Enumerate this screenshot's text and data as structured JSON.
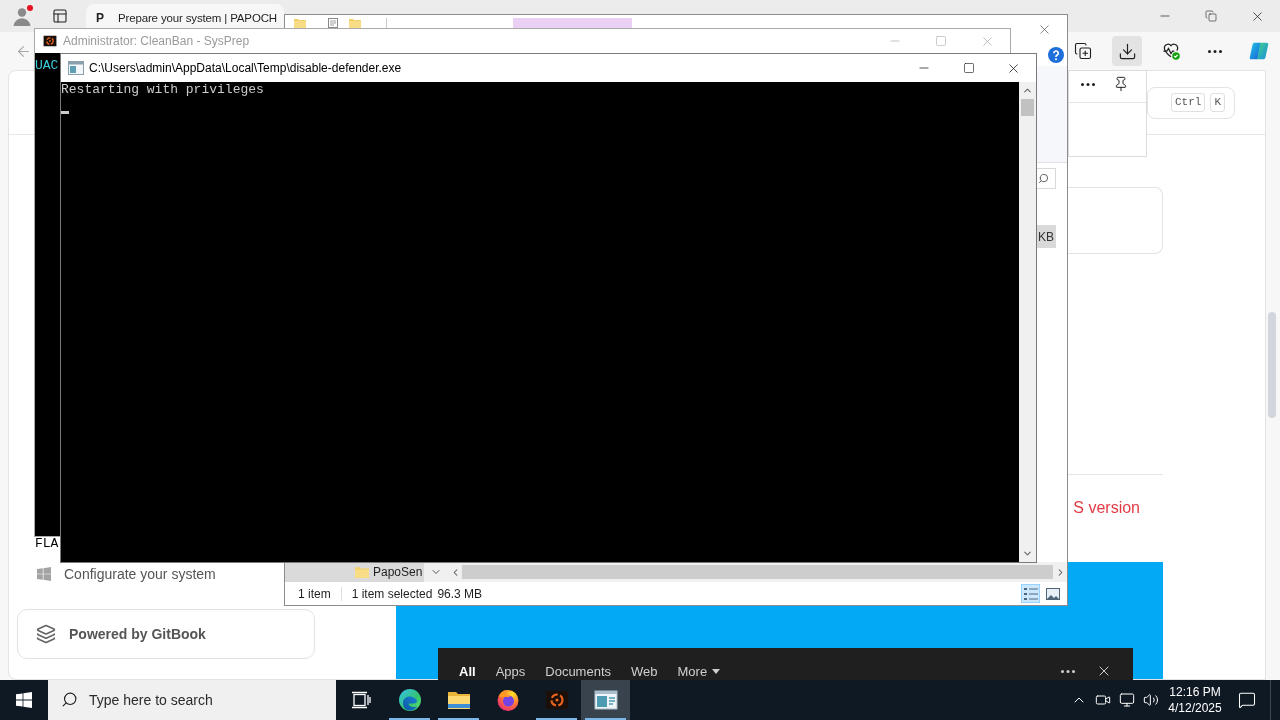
{
  "browser": {
    "tab": {
      "favicon": "P",
      "title": "Prepare your system | PAPOCH"
    },
    "toolbar_buttons": [
      {
        "kind": "collections",
        "selected": false
      },
      {
        "kind": "downloads",
        "selected": true
      },
      {
        "kind": "essentials",
        "selected": false
      },
      {
        "kind": "more",
        "selected": false
      },
      {
        "kind": "copilot",
        "selected": false
      }
    ],
    "search_shortcut": [
      "Ctrl",
      "K"
    ],
    "sidebar": {
      "fragment": "FLA",
      "items": [
        {
          "label": "Configurate your system"
        }
      ],
      "footer": "Powered by GitBook"
    },
    "content": {
      "fragment": "S version"
    }
  },
  "explorer": {
    "file_row": {
      "size": "KB",
      "selected": true
    },
    "nav_item": "PapoSen",
    "status_bar": {
      "item_count": "1 item",
      "selection": "1 item selected",
      "size": "96.3 MB"
    },
    "view_buttons": [
      {
        "kind": "details",
        "selected": true
      },
      {
        "kind": "large-icons",
        "selected": false
      }
    ]
  },
  "admin_console": {
    "title": "Administrator: CleanBan - SysPrep",
    "active": false,
    "lines": [
      "UAC"
    ]
  },
  "console": {
    "title": "C:\\Users\\admin\\AppData\\Local\\Temp\\disable-defender.exe",
    "active": true,
    "lines": [
      "Restarting with privileges"
    ],
    "cursor": true
  },
  "search_flyout": {
    "tabs": [
      {
        "label": "All",
        "selected": true,
        "kind": "tab"
      },
      {
        "label": "Apps",
        "selected": false,
        "kind": "tab"
      },
      {
        "label": "Documents",
        "selected": false,
        "kind": "tab"
      },
      {
        "label": "Web",
        "selected": false,
        "kind": "tab"
      },
      {
        "label": "More",
        "selected": false,
        "kind": "menu"
      }
    ]
  },
  "taskbar": {
    "search": {
      "placeholder": "Type here to search"
    },
    "apps": [
      {
        "kind": "task-view",
        "running": false,
        "selected": false
      },
      {
        "kind": "edge",
        "running": true,
        "selected": false
      },
      {
        "kind": "explorer",
        "running": true,
        "selected": false
      },
      {
        "kind": "firefox",
        "running": false,
        "selected": false
      },
      {
        "kind": "cleanban",
        "running": true,
        "selected": false
      },
      {
        "kind": "console",
        "running": true,
        "selected": true
      }
    ],
    "clock": {
      "time": "12:16 PM",
      "date": "4/12/2025"
    }
  }
}
